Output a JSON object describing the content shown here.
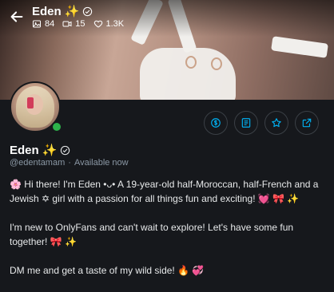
{
  "header": {
    "title": "Eden",
    "title_emoji": "✨",
    "stats": [
      {
        "icon": "image-icon",
        "value": "84"
      },
      {
        "icon": "video-icon",
        "value": "15"
      },
      {
        "icon": "heart-icon",
        "value": "1.3K"
      }
    ]
  },
  "profile": {
    "name": "Eden",
    "name_emoji": "✨",
    "handle": "@edentamam",
    "separator": "·",
    "status": "Available now",
    "online_color": "#2db14a"
  },
  "actions": [
    {
      "name": "tip-button",
      "icon": "dollar-icon"
    },
    {
      "name": "message-button",
      "icon": "chat-icon"
    },
    {
      "name": "favorite-button",
      "icon": "star-icon"
    },
    {
      "name": "share-button",
      "icon": "share-icon"
    }
  ],
  "bio": {
    "p1": "🌸 Hi there! I'm Eden •ᴗ• A 19-year-old half-Moroccan, half-French and a Jewish ✡ girl with a passion for all things fun and exciting! 💓 🎀 ✨",
    "p2": "I'm new to OnlyFans and can't wait to explore! Let's have some fun together! 🎀 ✨",
    "p3": "DM me and get a taste of my wild side! 🔥 💞"
  },
  "colors": {
    "accent": "#00aff0",
    "background": "#16181c",
    "muted": "#8b98a5"
  }
}
